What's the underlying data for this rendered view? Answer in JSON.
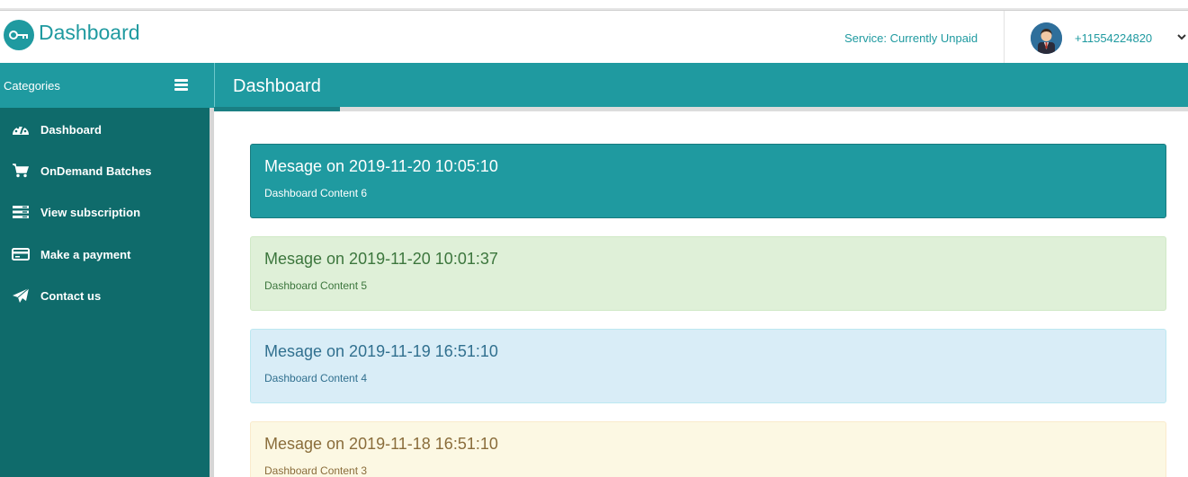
{
  "header": {
    "brand_title": "Dashboard",
    "service_status": "Service: Currently Unpaid",
    "phone": "+11554224820"
  },
  "sidebar": {
    "categories_label": "Categories",
    "items": [
      {
        "label": "Dashboard",
        "icon": "speedometer-icon"
      },
      {
        "label": "OnDemand Batches",
        "icon": "shopping-cart-icon"
      },
      {
        "label": "View subscription",
        "icon": "list-icon"
      },
      {
        "label": "Make a payment",
        "icon": "credit-card-icon"
      },
      {
        "label": "Contact us",
        "icon": "paper-plane-icon"
      }
    ]
  },
  "main": {
    "page_title": "Dashboard",
    "messages": [
      {
        "title": "Mesage on 2019-11-20 10:05:10",
        "body": "Dashboard Content 6",
        "variant": "primary"
      },
      {
        "title": "Mesage on 2019-11-20 10:01:37",
        "body": "Dashboard Content 5",
        "variant": "success"
      },
      {
        "title": "Mesage on 2019-11-19 16:51:10",
        "body": "Dashboard Content 4",
        "variant": "info"
      },
      {
        "title": "Mesage on 2019-11-18 16:51:10",
        "body": "Dashboard Content 3",
        "variant": "warning"
      }
    ]
  },
  "colors": {
    "brand": "#1f9aa0",
    "sidebar": "#0f6b6b",
    "primary_bg": "#1f9aa0",
    "success_bg": "#dff0d8",
    "info_bg": "#d9edf7",
    "warning_bg": "#fcf8e3"
  }
}
